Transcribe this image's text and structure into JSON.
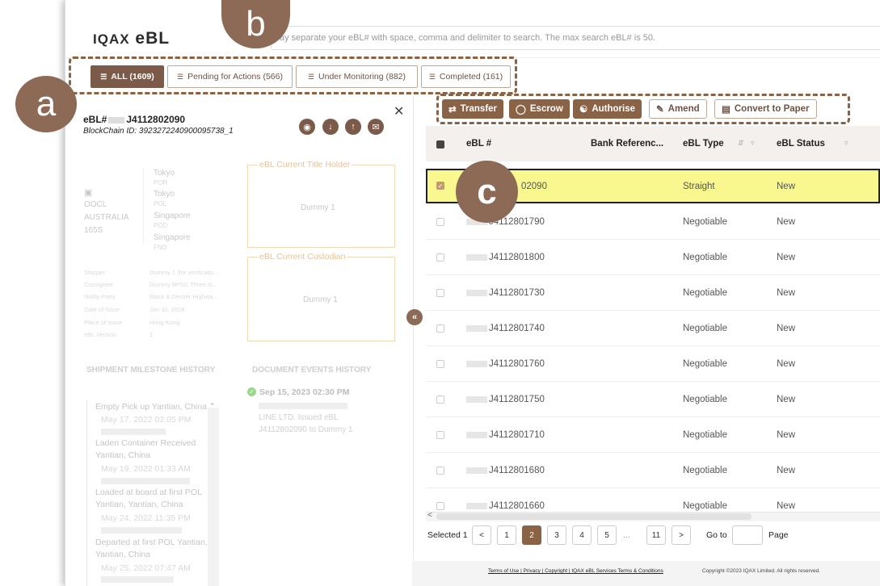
{
  "app": {
    "logo_icon": "IQAX",
    "logo_text": "eBL"
  },
  "search": {
    "placeholder": "ay separate your eBL# with space, comma and delimiter to search. The max search eBL# is 50."
  },
  "annotations": {
    "a": "a",
    "b": "b",
    "c": "c"
  },
  "tabs": [
    {
      "label": "ALL (1609)",
      "icon": "layers-icon"
    },
    {
      "label": "Pending for Actions (566)",
      "icon": "layers-icon"
    },
    {
      "label": "Under Monitoring (882)",
      "icon": "layers-icon"
    },
    {
      "label": "Completed (161)",
      "icon": "layers-icon"
    }
  ],
  "detail": {
    "ebl_prefix": "eBL#",
    "ebl_suffix": "J4112802090",
    "blockchain": "BlockChain ID: 3923272240900095738_1",
    "carrier": [
      "OOCL",
      "AUSTRALIA",
      "165S"
    ],
    "route": [
      {
        "city": "Tokyo",
        "code": "POR"
      },
      {
        "city": "Tokyo",
        "code": "POL"
      },
      {
        "city": "Singapore",
        "code": "POD"
      },
      {
        "city": "Singapore",
        "code": "FND"
      }
    ],
    "title_holder_label": "eBL Current Title Holder",
    "title_holder_value": "Dummy 1",
    "custodian_label": "eBL Current Custodian",
    "custodian_value": "Dummy 1",
    "info": [
      {
        "k": "Shipper",
        "v": "Dummy 1 (for verificatio..."
      },
      {
        "k": "Consignee",
        "v": "Dummy BPSC Three si..."
      },
      {
        "k": "Notify Party",
        "v": "Black & Decker Highwa..."
      },
      {
        "k": "Date of Issue",
        "v": "Jan 30, 2018"
      },
      {
        "k": "Place of Issue",
        "v": "Hong Kong"
      },
      {
        "k": "eBL Version",
        "v": "1"
      }
    ],
    "milestone_heading": "SHIPMENT MILESTONE HISTORY",
    "events_heading": "DOCUMENT EVENTS HISTORY",
    "milestones": [
      {
        "title": "Empty Pick up Yantian, China",
        "date": "May 17, 2022 02:05 PM"
      },
      {
        "title": "Laden Container Received Yantian, China",
        "date": "May 19, 2022 01:33 AM"
      },
      {
        "title": "Loaded at board at first POL Yantian, Yantian, China",
        "date": "May 24, 2022 11:35 PM"
      },
      {
        "title": "Departed at first POL Yantian, Yantian, China",
        "date": "May 25, 2022 07:47 AM"
      }
    ],
    "event": {
      "date": "Sep 15, 2023 02:30 PM",
      "line1": "LINE LTD. Issued eBL",
      "line2": "J4112802090 to Dummy 1"
    }
  },
  "actions": [
    {
      "label": "Transfer",
      "icon": "transfer-icon",
      "style": "fill"
    },
    {
      "label": "Escrow",
      "icon": "shield-icon",
      "style": "fill"
    },
    {
      "label": "Authorise",
      "icon": "users-icon",
      "style": "fill"
    },
    {
      "label": "Amend",
      "icon": "edit-icon",
      "style": "out"
    },
    {
      "label": "Convert to Paper",
      "icon": "document-icon",
      "style": "out"
    }
  ],
  "table": {
    "headers": [
      "eBL #",
      "Bank Referenc...",
      "eBL Type",
      "eBL Status"
    ],
    "rows": [
      {
        "ebl": "02090",
        "type": "Straight",
        "status": "New",
        "selected": true
      },
      {
        "ebl": "J4112801790",
        "type": "Negotiable",
        "status": "New"
      },
      {
        "ebl": "J4112801800",
        "type": "Negotiable",
        "status": "New"
      },
      {
        "ebl": "J4112801730",
        "type": "Negotiable",
        "status": "New"
      },
      {
        "ebl": "J4112801740",
        "type": "Negotiable",
        "status": "New"
      },
      {
        "ebl": "J4112801760",
        "type": "Negotiable",
        "status": "New"
      },
      {
        "ebl": "J4112801750",
        "type": "Negotiable",
        "status": "New"
      },
      {
        "ebl": "J4112801710",
        "type": "Negotiable",
        "status": "New"
      },
      {
        "ebl": "J4112801680",
        "type": "Negotiable",
        "status": "New"
      },
      {
        "ebl": "J4112801660",
        "type": "Negotiable",
        "status": "New"
      }
    ]
  },
  "pagination": {
    "selected": "Selected 1",
    "prev": "<",
    "next": ">",
    "pages": [
      "1",
      "2",
      "3",
      "4",
      "5",
      "...",
      "11"
    ],
    "active": "2",
    "goto": "Go to",
    "page": "Page"
  },
  "footer": {
    "links": "Terms of Use | Privacy | Copyright | IQAX eBL Services Terms & Conditions",
    "copyright": "Copyright ©2023 IQAX Limited. All rights reserved."
  },
  "colors": {
    "brand": "#8a6347",
    "highlight": "#f8f88e",
    "callout": "#8d6a55"
  }
}
